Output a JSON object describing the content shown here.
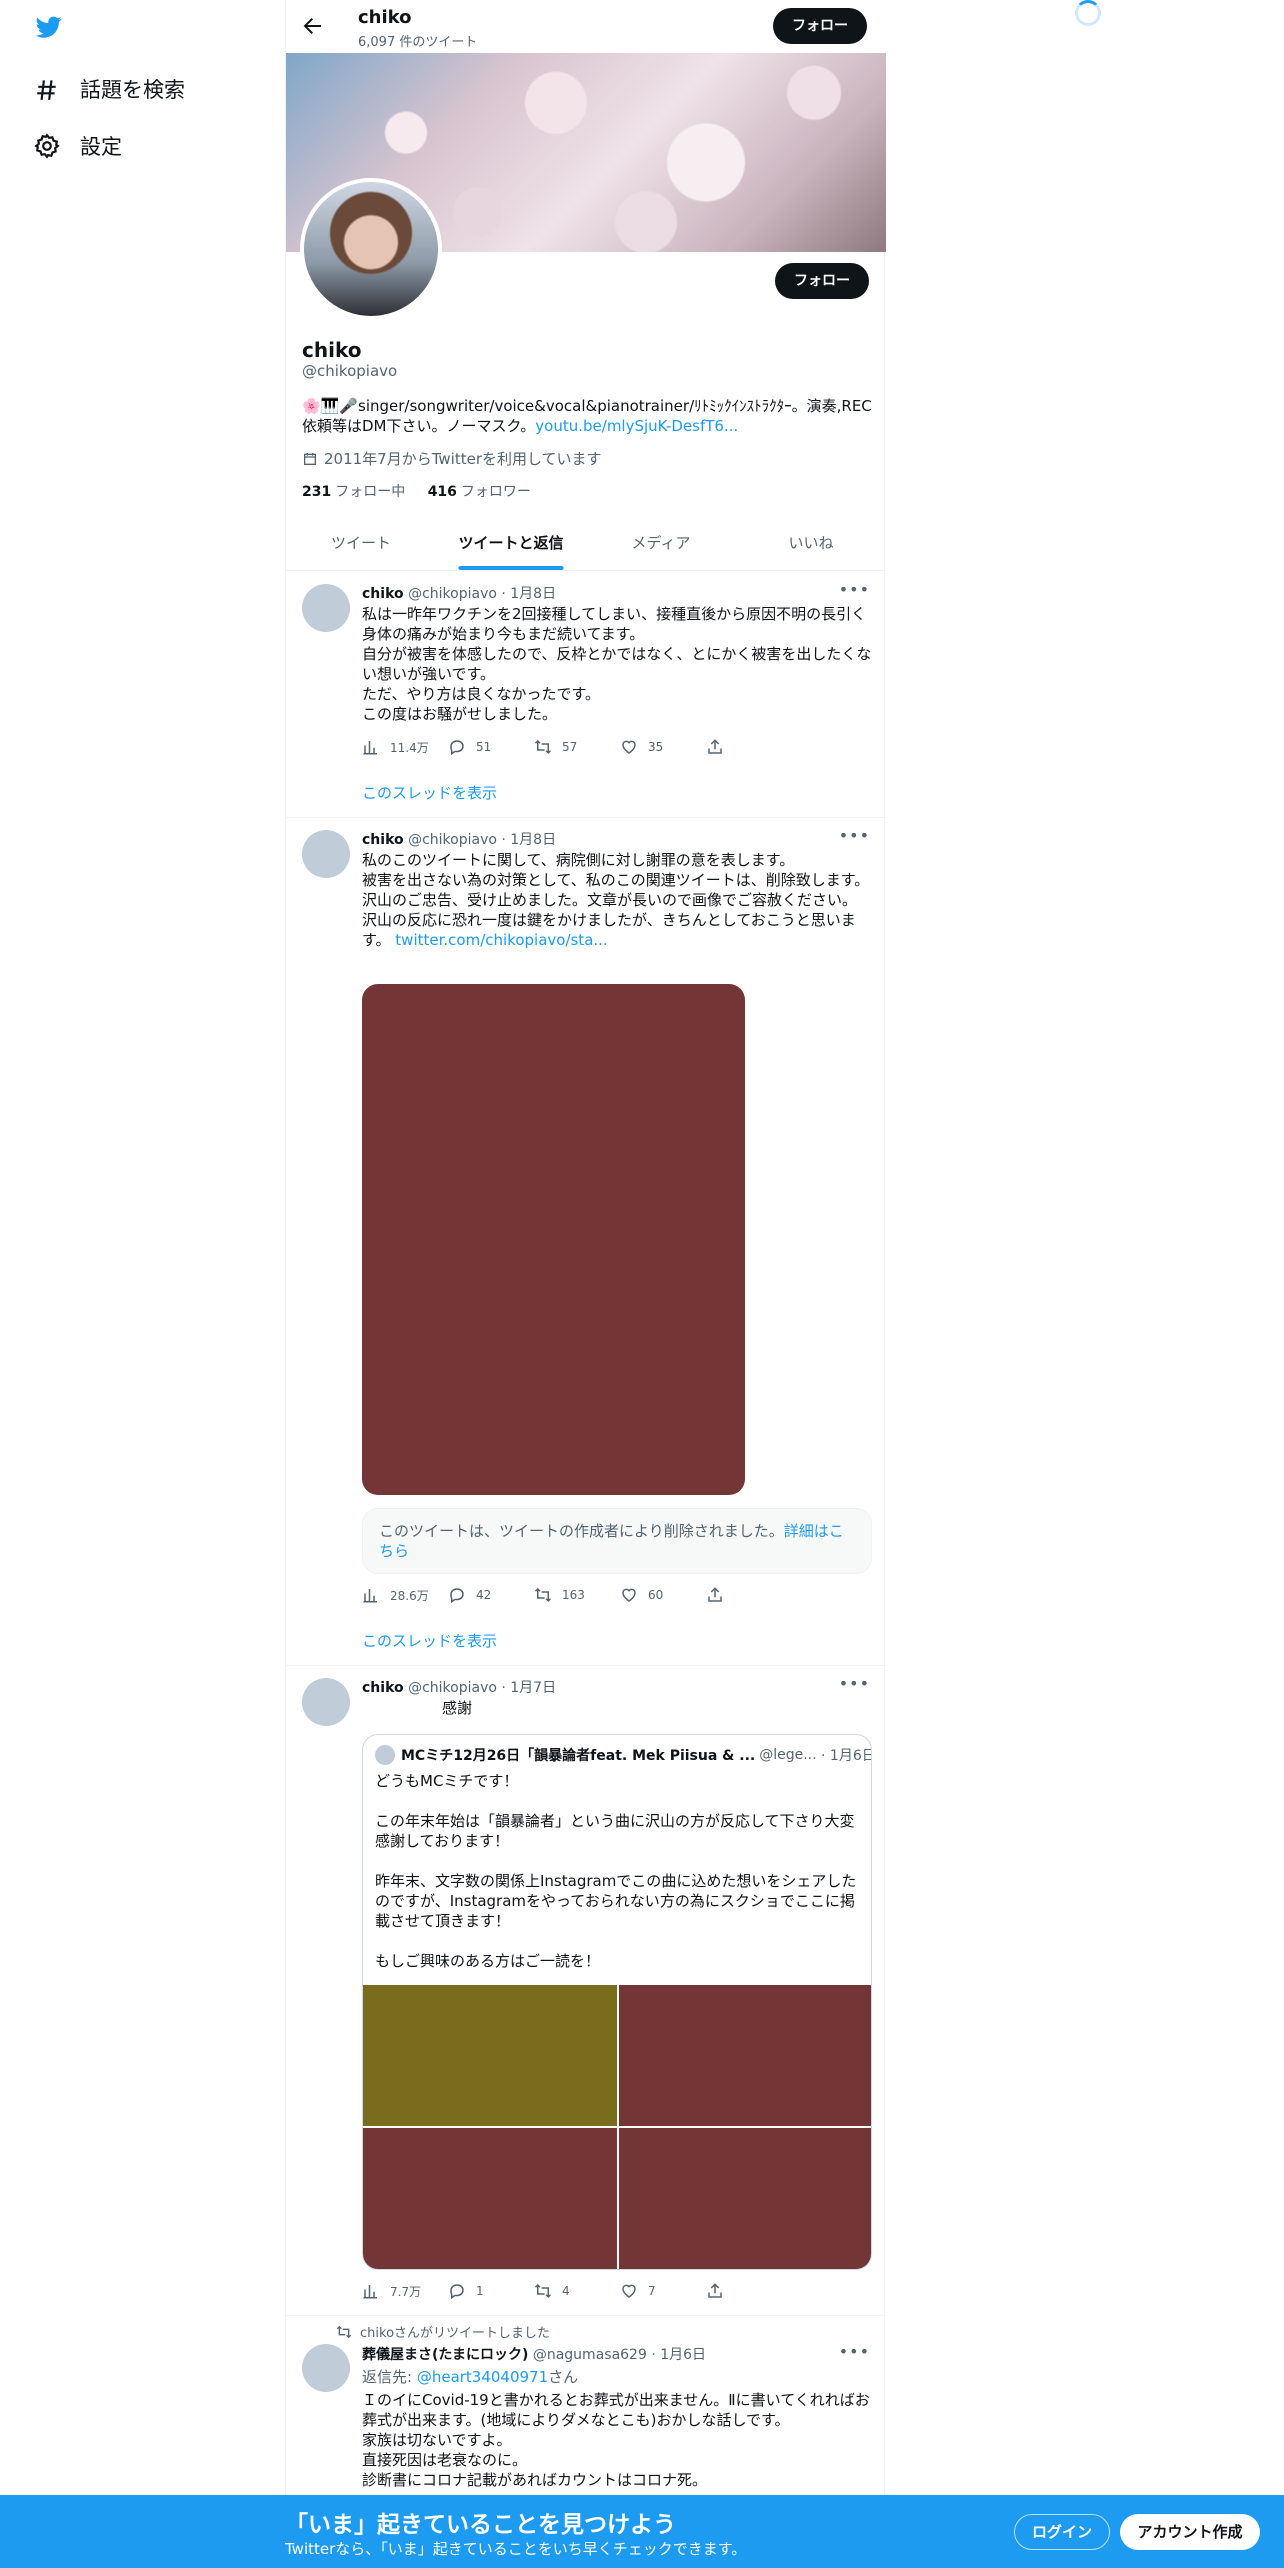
{
  "nav": {
    "items": [
      {
        "label": "話題を検索",
        "icon": "hashtag-icon"
      },
      {
        "label": "設定",
        "icon": "gear-icon"
      }
    ]
  },
  "topbar": {
    "name": "chiko",
    "tweet_count": "6,097 件のツイート",
    "follow_label": "フォロー"
  },
  "profile": {
    "name": "chiko",
    "handle": "@chikopiavo",
    "follow_label": "フォロー",
    "bio_text": "🌸🎹🎤singer/songwriter/voice&vocal&pianotrainer/ﾘﾄﾐｯｸｲﾝｽﾄﾗｸﾀｰ。演奏,REC依頼等はDM下さい。ノーマスク。",
    "bio_link": "youtu.be/mlySjuK-DesfT6...",
    "joined": "2011年7月からTwitterを利用しています",
    "following_count": "231",
    "following_label": "フォロー中",
    "followers_count": "416",
    "followers_label": "フォロワー"
  },
  "tabs": [
    {
      "label": "ツイート",
      "active": false
    },
    {
      "label": "ツイートと返信",
      "active": true
    },
    {
      "label": "メディア",
      "active": false
    },
    {
      "label": "いいね",
      "active": false
    }
  ],
  "tweets": [
    {
      "name": "chiko",
      "handle": "@chikopiavo",
      "date": "· 1月8日",
      "lines": [
        "私は一昨年ワクチンを2回接種してしまい、接種直後から原因不明の長引く身体の痛みが始まり今もまだ続いてます。",
        "自分が被害を体感したので、反枠とかではなく、とにかく被害を出したくない想いが強いです。",
        "ただ、やり方は良くなかったです。",
        "この度はお騒がせしました。"
      ],
      "views": "11.4万",
      "replies": "51",
      "retweets": "57",
      "likes": "35",
      "show_thread": "このスレッドを表示"
    },
    {
      "name": "chiko",
      "handle": "@chikopiavo",
      "date": "· 1月8日",
      "lines": [
        "私のこのツイートに関して、病院側に対し謝罪の意を表します。",
        "被害を出さない為の対策として、私のこの関連ツイートは、削除致します。",
        "沢山のご忠告、受け止めました。文章が長いので画像でご容赦ください。",
        "沢山の反応に恐れ一度は鍵をかけましたが、きちんとしておこうと思います。"
      ],
      "link": "twitter.com/chikopiavo/sta...",
      "media_color": "#733535",
      "deleted_text": "このツイートは、ツイートの作成者により削除されました。",
      "deleted_link": "詳細はこちら",
      "views": "28.6万",
      "replies": "42",
      "retweets": "163",
      "likes": "60",
      "show_thread": "このスレッドを表示"
    },
    {
      "name": "chiko",
      "handle": "@chikopiavo",
      "date": "· 1月7日",
      "text": "感謝",
      "quote": {
        "name": "MCミチ12月26日「韻暴論者feat. Mek Piisua & ...",
        "handle": "@lege...",
        "date": "· 1月6日",
        "text": "どうもMCミチです！\n\nこの年末年始は「韻暴論者」という曲に沢山の方が反応して下さり大変感謝しております！\n\n昨年末、文字数の関係上Instagramでこの曲に込めた想いをシェアしたのですが、Instagramをやっておられない方の為にスクショでここに掲載させて頂きます！\n\nもしご興味のある方はご一読を！",
        "image_colors": [
          "#7a6c1d",
          "#733535",
          "#733535",
          "#733535"
        ]
      },
      "views": "7.7万",
      "replies": "1",
      "retweets": "4",
      "likes": "7"
    },
    {
      "retweet_label": "chikoさんがリツイートしました",
      "name": "葬儀屋まさ(たまにロック)",
      "handle": "@nagumasa629",
      "date": "· 1月6日",
      "reply_prefix": "返信先: ",
      "reply_to": "@heart34040971",
      "reply_suffix": "さん",
      "lines": [
        "ＩのイにCovid-19と書かれるとお葬式が出来ません。Ⅱに書いてくれればお葬式が出来ます。(地域によりダメなとこも)おかしな話しです。",
        "家族は切ないですよ。",
        "直接死因は老衰なのに。",
        "診断書にコロナ記載があればカウントはコロナ死。"
      ]
    }
  ],
  "bottom_bar": {
    "title": "「いま」起きていることを見つけよう",
    "subtitle": "Twitterなら、「いま」起きていることをいち早くチェックできます。",
    "login": "ログイン",
    "signup": "アカウント作成"
  },
  "colors": {
    "accent": "#1d9bf0",
    "dark": "#0f1419",
    "secondary": "#536471"
  }
}
